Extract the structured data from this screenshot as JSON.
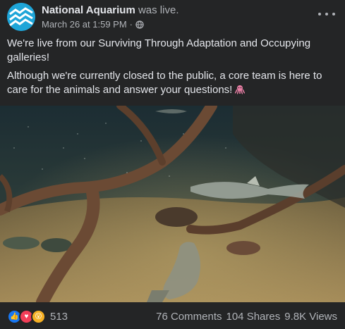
{
  "header": {
    "page_name": "National Aquarium",
    "status": "was live.",
    "date": "March 26 at 1:59 PM",
    "separator": "·",
    "privacy_icon": "globe-icon",
    "more_icon": "more-options-icon"
  },
  "post": {
    "paragraph_1": "We're live from our Surviving Through Adaptation and Occupying galleries!",
    "paragraph_2": "Although we're currently closed to the public, a core team is here to care for the animals and answer your questions!",
    "emoji": "octopus-icon"
  },
  "video": {
    "description_icon": "live-video-thumbnail"
  },
  "footer": {
    "reaction_icons": [
      "like-icon",
      "love-icon",
      "wow-icon"
    ],
    "reaction_count": "513",
    "comments": "76 Comments",
    "shares": "104 Shares",
    "views": "9.8K Views"
  },
  "colors": {
    "background": "#242526",
    "primary_text": "#e4e6eb",
    "secondary_text": "#b0b3b8",
    "like_blue": "#1877f2",
    "love_red": "#f33e58",
    "wow_yellow": "#f7b125",
    "avatar_blue": "#1ea5d8"
  }
}
